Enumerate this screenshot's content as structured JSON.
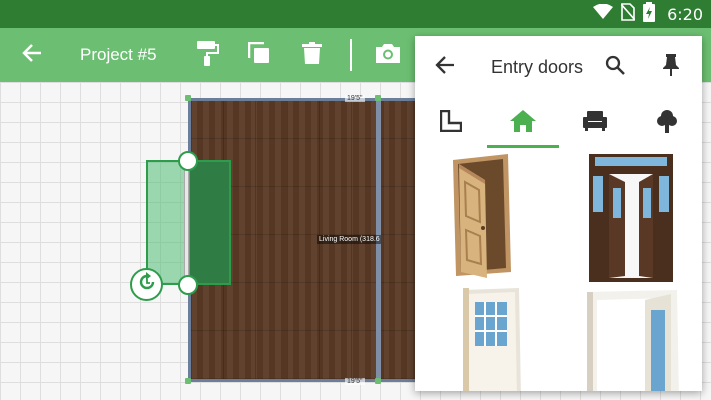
{
  "status_bar": {
    "time": "6:20",
    "icons": [
      "wifi-icon",
      "no-sim-icon",
      "battery-icon"
    ]
  },
  "toolbar": {
    "title": "Project #5",
    "back_icon": "arrow-back-icon",
    "tools": [
      "paint-roller-icon",
      "copy-icon",
      "delete-icon",
      "camera-icon"
    ]
  },
  "canvas": {
    "room_label": "Living Room (318.6",
    "dim_top": "19'5\"",
    "dim_bottom": "19'5\""
  },
  "catalog": {
    "title": "Entry doors",
    "tabs": [
      "floor-plan-icon",
      "home-icon",
      "sofa-icon",
      "tree-icon"
    ],
    "active_tab": 1,
    "items": [
      "wooden-panel-door",
      "double-glazed-door",
      "white-glass-door",
      "white-open-door"
    ]
  },
  "colors": {
    "accent": "#6cbf72",
    "status": "#2e7d32",
    "selection": "#2e9d4b"
  }
}
